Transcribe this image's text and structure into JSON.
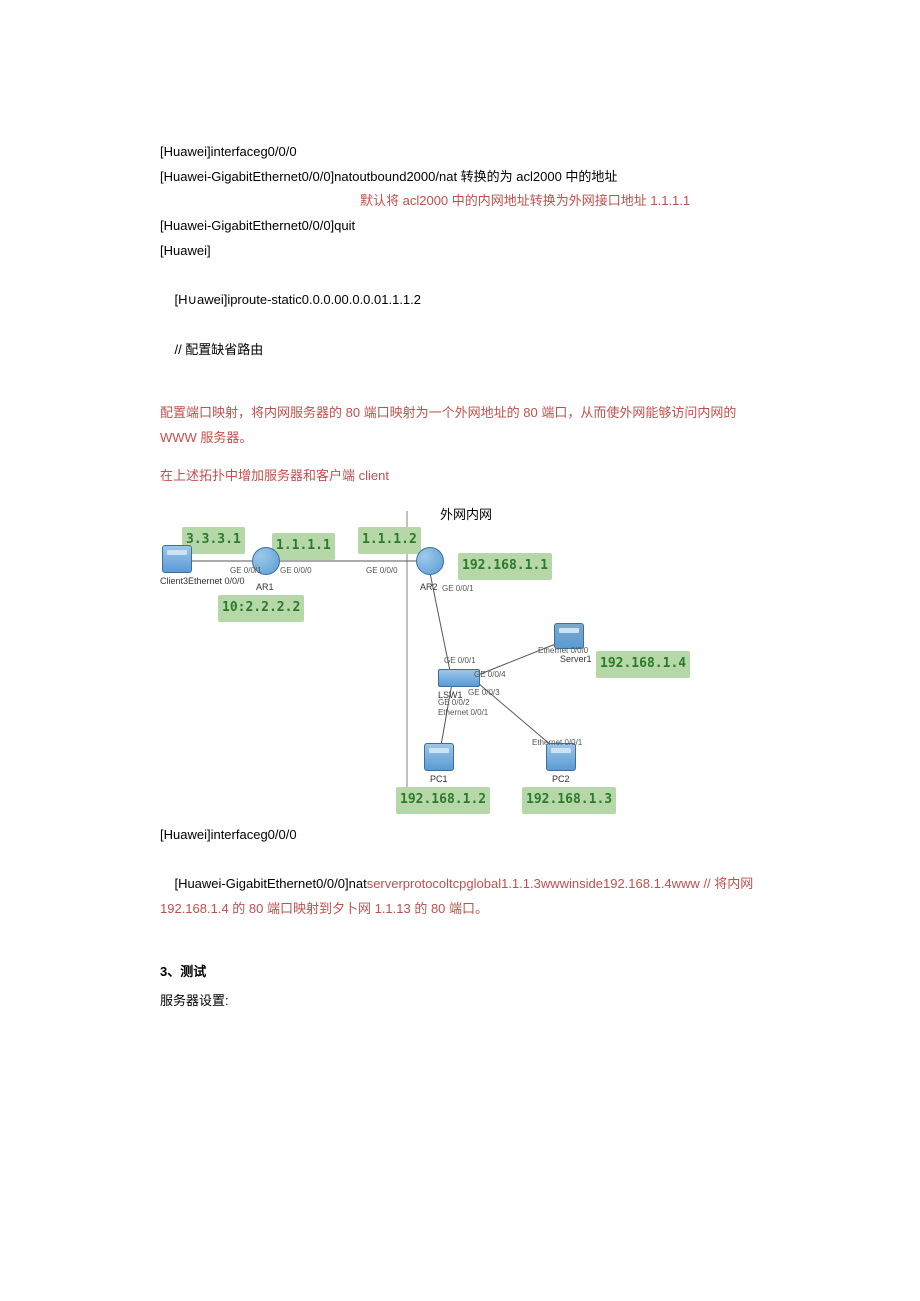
{
  "cmd": {
    "l1": "[Huawei]interfaceg0/0/0",
    "l2a": "[Huawei-GigabitEthernet0/0/0]natoutbound2000/nat 转换的为 acl2000 中的地址",
    "l2b": "默认将 acl2000 中的内网地址转换为外网接口地址 1.1.1.1",
    "l3": "[Huawei-GigabitEthernet0/0/0]quit",
    "l4": "[Huawei]",
    "l5a": "[H∪awei]iproute-static0.0.0.00.0.0.01.1.1.2",
    "l5b": "// 配置缺省路由"
  },
  "para1": "配置端口映射，将内网服务器的 80 端口映射为一个外网地址的 80 端口，从而使外网能够访问内网的 WWW 服务器。",
  "para2": "在上述拓扑中增加服务器和客户端 client",
  "diagram": {
    "title": "外网内网",
    "ip_3_3_3_1": "3.3.3.1",
    "ip_1_1_1_1": "1.1.1.1",
    "ip_1_1_1_2": "1.1.1.2",
    "ip_192_168_1_1": "192.168.1.1",
    "ip_10_2_2_2_2": "10:2.2.2.2",
    "ip_192_168_1_4": "192.168.1.4",
    "ip_192_168_1_2": "192.168.1.2",
    "ip_192_168_1_3": "192.168.1.3",
    "client3": "Client3",
    "eth000": "Ethernet 0/0/0",
    "ar1": "AR1",
    "ar2": "AR2",
    "ge001": "GE 0/0/1",
    "ge000": "GE 0/0/0",
    "ge002": "GE 0/0/2",
    "ge003": "GE 0/0/3",
    "ge004": "GE 0/0/4",
    "server1": "Server1",
    "lsw1": "LSW1",
    "eth001": "Ethernet 0/0/1",
    "pc1": "PC1",
    "pc2": "PC2"
  },
  "cmd2": {
    "l1": "[Huawei]interfaceg0/0/0",
    "l2a": "[Huawei-GigabitEthernet0/0/0]nat",
    "l2b": "serverprotocoltcpglobal1.1.1.3wwwinside192.168.1.4www",
    "l2c": " // 将内网 192.168.1.4 的 80 端口映射到夕卜网 1.1.13 的 80 端口。"
  },
  "sec3": {
    "h": "3、测试",
    "l": "服务器设置:"
  }
}
